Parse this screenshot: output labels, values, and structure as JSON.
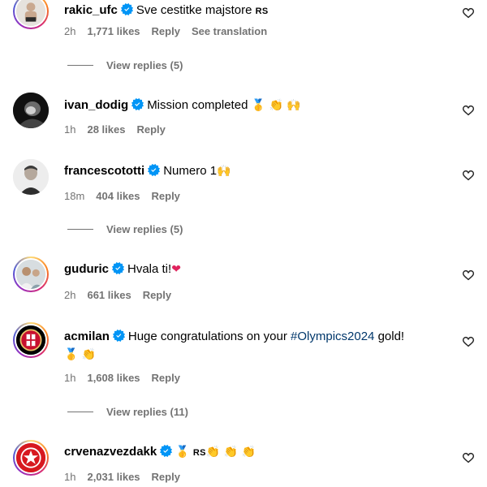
{
  "comments": [
    {
      "username": "rakic_ufc",
      "text": "Sve cestitke majstore",
      "flag": "RS",
      "time": "2h",
      "likes": "1,771 likes",
      "reply": "Reply",
      "translate": "See translation",
      "view_replies": "View replies (5)"
    },
    {
      "username": "ivan_dodig",
      "text": "Mission completed",
      "emojis": "🥇 👏 🙌",
      "time": "1h",
      "likes": "28 likes",
      "reply": "Reply"
    },
    {
      "username": "francescototti",
      "text": "Numero 1",
      "emojis": "🙌",
      "time": "18m",
      "likes": "404 likes",
      "reply": "Reply",
      "view_replies": "View replies (5)"
    },
    {
      "username": "guduric",
      "text": "Hvala ti!",
      "emojis": "❤",
      "time": "2h",
      "likes": "661 likes",
      "reply": "Reply"
    },
    {
      "username": "acmilan",
      "text_before": "Huge congratulations on your ",
      "hashtag": "#Olympics2024",
      "text_after": " gold!",
      "emojis": "🥇 👏",
      "time": "1h",
      "likes": "1,608 likes",
      "reply": "Reply",
      "view_replies": "View replies (11)"
    },
    {
      "username": "crvenazvezdakk",
      "emojis_before": "🥇",
      "flag": "RS",
      "emojis": "👏 👏 👏",
      "time": "1h",
      "likes": "2,031 likes",
      "reply": "Reply"
    }
  ],
  "colors": {
    "verified": "#0095f6",
    "meta": "#737373",
    "hashtag": "#00376b",
    "heart_red": "#e0245e"
  },
  "icons": {
    "verified": "verified-badge-icon",
    "like": "heart-outline-icon"
  }
}
